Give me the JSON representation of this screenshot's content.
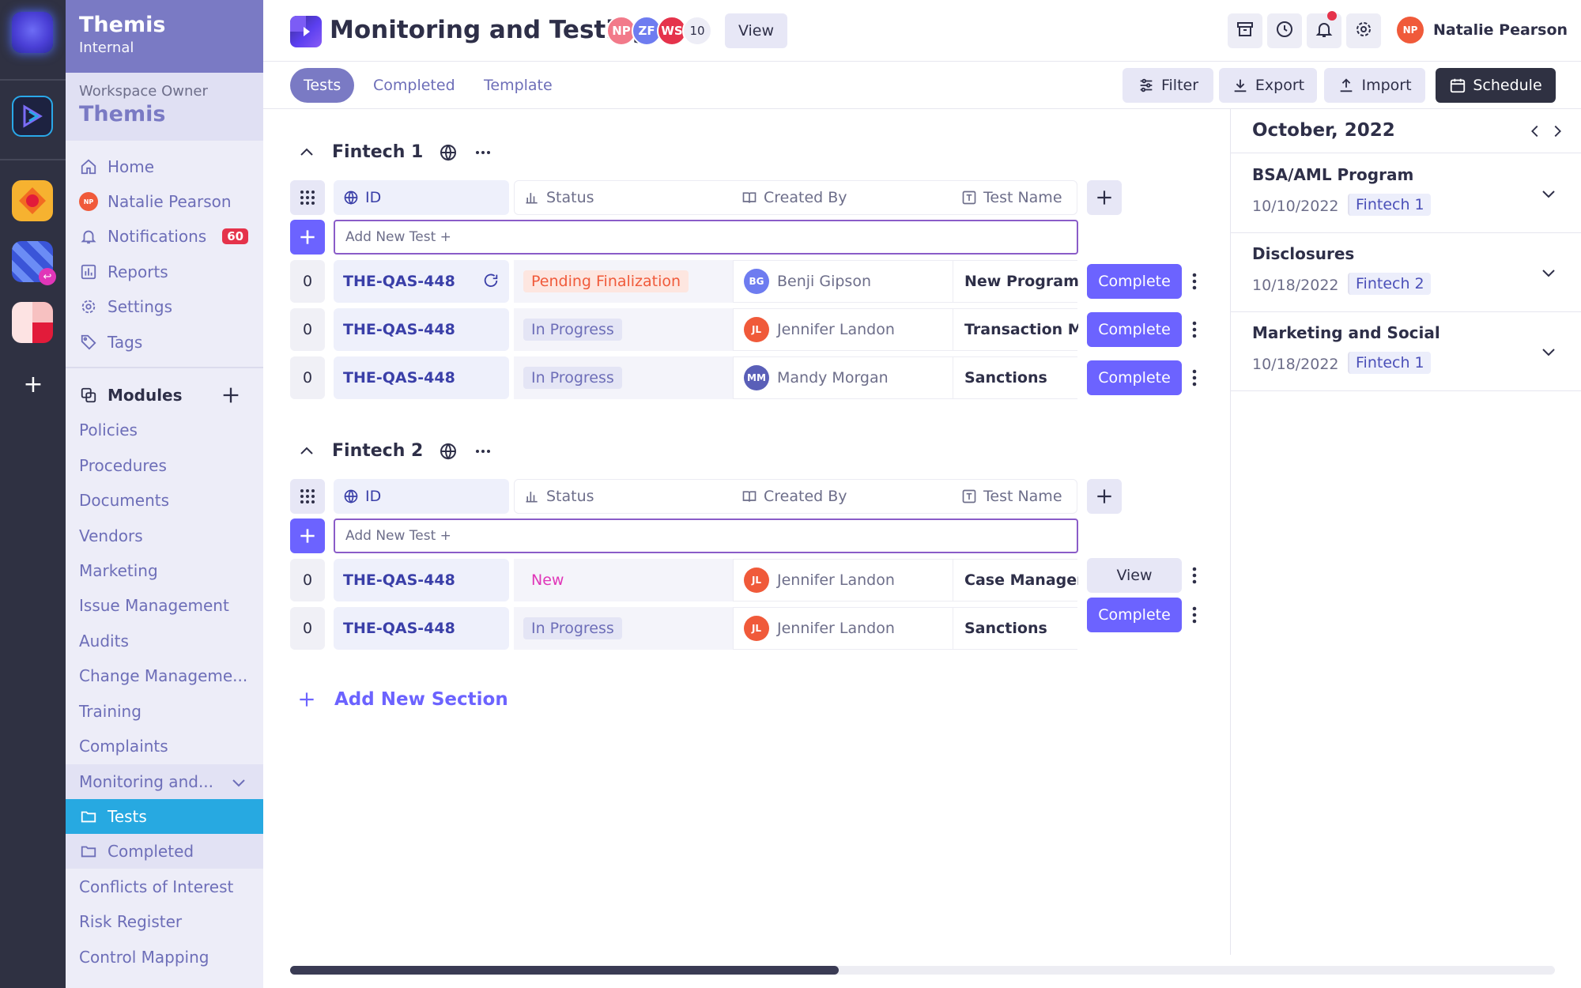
{
  "sidebar": {
    "org_name": "Themis",
    "org_type": "Internal",
    "owner_label": "Workspace Owner",
    "owner_name": "Themis",
    "nav": {
      "home": "Home",
      "user": "Natalie Pearson",
      "user_initials": "NP",
      "notifications": "Notifications",
      "notifications_count": "60",
      "reports": "Reports",
      "settings": "Settings",
      "tags": "Tags"
    },
    "modules_label": "Modules",
    "modules": [
      "Policies",
      "Procedures",
      "Documents",
      "Vendors",
      "Marketing",
      "Issue Management",
      "Audits",
      "Change Manageme...",
      "Training",
      "Complaints",
      "Monitoring and...",
      "Tests",
      "Completed",
      "Conflicts of Interest",
      "Risk Register",
      "Control Mapping"
    ]
  },
  "header": {
    "title": "Monitoring and Testing",
    "avatars": [
      {
        "initials": "NP",
        "color": "#f27a8a"
      },
      {
        "initials": "ZF",
        "color": "#6e7cf0"
      },
      {
        "initials": "WS",
        "color": "#e5334b"
      }
    ],
    "more_count": "10",
    "view_label": "View",
    "user_name": "Natalie Pearson",
    "user_initials": "NP"
  },
  "tabs": [
    "Tests",
    "Completed",
    "Template"
  ],
  "toolbar": {
    "filter": "Filter",
    "export": "Export",
    "import": "Import",
    "schedule": "Schedule"
  },
  "columns": {
    "id": "ID",
    "status": "Status",
    "created_by": "Created By",
    "test_name": "Test Name"
  },
  "add_test_placeholder": "Add New Test +",
  "sections": [
    {
      "name": "Fintech 1",
      "rows": [
        {
          "count": "0",
          "id": "THE-QAS-448",
          "status": "Pending Finalization",
          "creator": "Benji Gipson",
          "initials": "BG",
          "name": "New Program",
          "action": "Complete"
        },
        {
          "count": "0",
          "id": "THE-QAS-448",
          "status": "In Progress",
          "creator": "Jennifer Landon",
          "initials": "JL",
          "name": "Transaction Mo",
          "action": "Complete"
        },
        {
          "count": "0",
          "id": "THE-QAS-448",
          "status": "In Progress",
          "creator": "Mandy Morgan",
          "initials": "MM",
          "name": "Sanctions",
          "action": "Complete"
        }
      ]
    },
    {
      "name": "Fintech 2",
      "rows": [
        {
          "count": "0",
          "id": "THE-QAS-448",
          "status": "New",
          "creator": "Jennifer Landon",
          "initials": "JL",
          "name": "Case Managem",
          "action": "View"
        },
        {
          "count": "0",
          "id": "THE-QAS-448",
          "status": "In Progress",
          "creator": "Jennifer Landon",
          "initials": "JL",
          "name": "Sanctions",
          "action": "Complete"
        }
      ]
    }
  ],
  "add_section_label": "Add New Section",
  "calendar": {
    "month": "October, 2022",
    "items": [
      {
        "title": "BSA/AML Program",
        "date": "10/10/2022",
        "tag": "Fintech 1"
      },
      {
        "title": "Disclosures",
        "date": "10/18/2022",
        "tag": "Fintech 2"
      },
      {
        "title": "Marketing and Social",
        "date": "10/18/2022",
        "tag": "Fintech 1"
      }
    ]
  },
  "colors": {
    "accent": "#6c63ff",
    "sidebar_header": "#7a7ac4",
    "active_nav": "#27a9e1",
    "rail": "#2f3142",
    "pending": "#f05a3a",
    "new": "#e036b8"
  }
}
